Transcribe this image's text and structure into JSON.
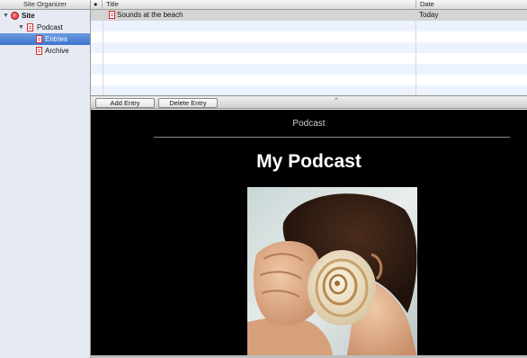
{
  "sidebar": {
    "title": "Site Organizer",
    "items": [
      {
        "label": "Site",
        "icon": "site-icon",
        "expanded": true
      },
      {
        "label": "Podcast",
        "icon": "document-icon",
        "expanded": true
      },
      {
        "label": "Entries",
        "icon": "document-icon",
        "selected": true
      },
      {
        "label": "Archive",
        "icon": "document-icon"
      }
    ]
  },
  "table": {
    "columns": [
      {
        "label": "●"
      },
      {
        "label": "Title"
      },
      {
        "label": "Date"
      }
    ],
    "rows": [
      {
        "title": "Sounds at the beach",
        "date": "Today",
        "icon": "document-icon",
        "selected": true
      }
    ]
  },
  "toolbar": {
    "add_label": "Add Entry",
    "delete_label": "Delete Entry",
    "splitter_glyph": "⌃"
  },
  "preview": {
    "site_name": "Podcast",
    "title": "My Podcast",
    "image_subject": "child-holding-seashell-to-ear"
  },
  "colors": {
    "sidebar_bg": "#e6ebf3",
    "selection": "#3f74cf",
    "row_selected": "#d4d4d4",
    "stripe": "#edf3fe",
    "preview_bg": "#000000",
    "icon_red": "#d02b2b"
  }
}
